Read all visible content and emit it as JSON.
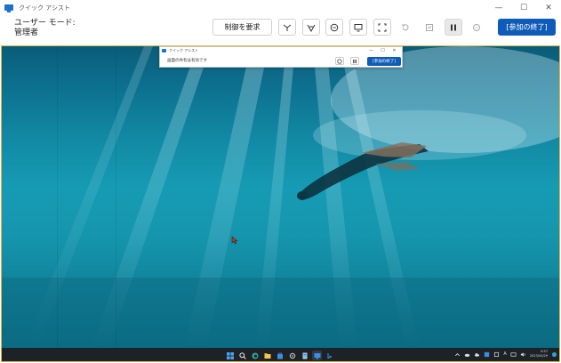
{
  "window": {
    "title": "クイック アシスト",
    "minimize": "—",
    "maximize": "☐",
    "close": "✕"
  },
  "toolbar": {
    "mode_label": "ユーザー モード:",
    "mode_value": "管理者",
    "show_controls": "制御を要求",
    "end_label": "[参加の終了]",
    "icons": [
      "laser-pointer-icon",
      "annotate-icon",
      "chat-icon",
      "select-monitor-icon",
      "fullscreen-icon",
      "restart-icon",
      "task-manager-icon",
      "pause-icon",
      "settings-icon"
    ]
  },
  "shared_screen": {
    "inner_window": {
      "title": "クイック アシスト",
      "status": "画面の共有は有効です",
      "end_label": "[参加の終了]",
      "minimize": "—",
      "maximize": "☐",
      "close": "✕"
    },
    "taskbar": {
      "time": "9:57",
      "date": "2023/04/29"
    }
  },
  "colors": {
    "accent": "#0f5bb8",
    "ocean_deep": "#0a5c78",
    "ocean_light": "#169bb4",
    "taskbar": "#1c2228"
  }
}
